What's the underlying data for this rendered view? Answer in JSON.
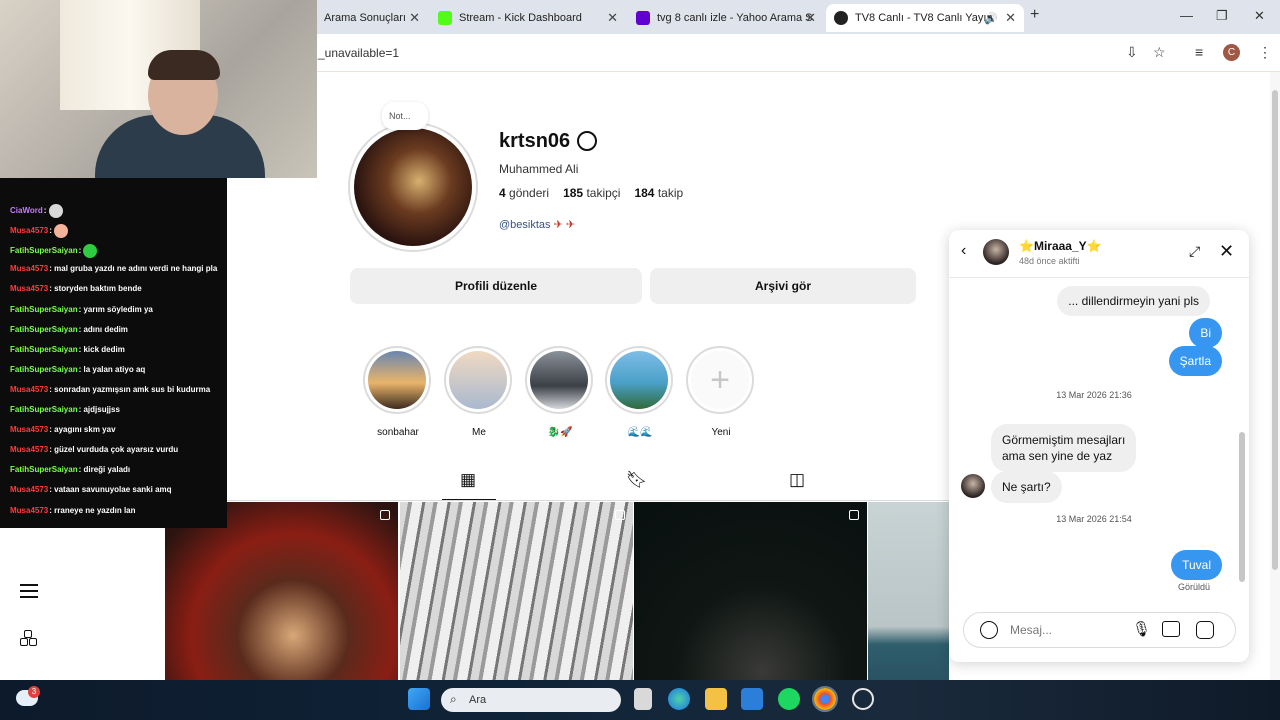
{
  "browser": {
    "tabs": [
      {
        "label": "Arama Sonuçları",
        "favicon_color": "#dfe3eb"
      },
      {
        "label": "Stream - Kick Dashboard",
        "favicon_color": "#53fc18"
      },
      {
        "label": "tvg 8 canlı izle - Yahoo Arama S",
        "favicon_color": "#6001d2"
      },
      {
        "label": "TV8 Canlı - TV8 Canlı Yayın",
        "favicon_color": "#222222"
      }
    ],
    "new_tab": "+",
    "url": "_unavailable=1",
    "profile_initial": "C"
  },
  "chat": {
    "messages": [
      {
        "user": "CiaWord",
        "text": "",
        "color": "#c97cff",
        "emoji": true,
        "emoji_color": "#d9d9d9"
      },
      {
        "user": "Musa4573",
        "text": "",
        "color": "#ff3b3b",
        "emoji": true,
        "emoji_color": "#f4b29a"
      },
      {
        "user": "FatihSuperSaiyan",
        "text": "",
        "color": "#7cff4b",
        "emoji": true,
        "emoji_color": "#2ecc40"
      },
      {
        "user": "Musa4573",
        "text": "mal gruba yazdı ne adını verdi ne hangi pla",
        "color": "#ff3b3b"
      },
      {
        "user": "Musa4573",
        "text": "storyden baktım bende",
        "color": "#ff3b3b"
      },
      {
        "user": "FatihSuperSaiyan",
        "text": "yarım söyledim ya",
        "color": "#7cff4b"
      },
      {
        "user": "FatihSuperSaiyan",
        "text": "adını dedim",
        "color": "#7cff4b"
      },
      {
        "user": "FatihSuperSaiyan",
        "text": "kick dedim",
        "color": "#7cff4b"
      },
      {
        "user": "FatihSuperSaiyan",
        "text": "la yalan atiyo aq",
        "color": "#7cff4b"
      },
      {
        "user": "Musa4573",
        "text": "sonradan yazmışsın amk sus bi kudurma",
        "color": "#ff3b3b"
      },
      {
        "user": "FatihSuperSaiyan",
        "text": "ajdjsujjss",
        "color": "#7cff4b"
      },
      {
        "user": "Musa4573",
        "text": "ayagını skm yav",
        "color": "#ff3b3b"
      },
      {
        "user": "Musa4573",
        "text": "güzel vurduda çok ayarsız vurdu",
        "color": "#ff3b3b"
      },
      {
        "user": "FatihSuperSaiyan",
        "text": "direği yaladı",
        "color": "#7cff4b"
      },
      {
        "user": "Musa4573",
        "text": "vataan savunuyolae sanki amq",
        "color": "#ff3b3b"
      },
      {
        "user": "Musa4573",
        "text": "rraneye ne yazdın lan",
        "color": "#ff3b3b"
      }
    ]
  },
  "profile": {
    "note": "Not...",
    "username": "krtsn06",
    "full_name": "Muhammed Ali",
    "posts_count": "4",
    "posts_label": "gönderi",
    "followers_count": "185",
    "followers_label": "takipçi",
    "following_count": "184",
    "following_label": "takip",
    "link": "@besiktas",
    "edit_button": "Profili düzenle",
    "archive_button": "Arşivi gör",
    "highlights": [
      {
        "label": "sonbahar",
        "color1": "#e9b46a",
        "color2": "#3a4b6b"
      },
      {
        "label": "Me",
        "color1": "#f0d9c2",
        "color2": "#8ea6c4"
      },
      {
        "label": "🐉🚀",
        "color1": "#b7bcc3",
        "color2": "#3b4047"
      },
      {
        "label": "🌊🌊",
        "color1": "#7dbde8",
        "color2": "#2f6b3a"
      },
      {
        "label": "Yeni",
        "color1": "#fafafa",
        "color2": "#fafafa"
      }
    ]
  },
  "dm": {
    "name": "⭐Miraaa_Y⭐",
    "status": "48d önce aktifti",
    "messages": [
      {
        "kind": "in_top",
        "text": "... dillendirmeyin yani pls"
      },
      {
        "kind": "out",
        "text": "Bi"
      },
      {
        "kind": "out",
        "text": "Şartla"
      },
      {
        "kind": "stamp",
        "text": "13 Mar 2026 21:36"
      },
      {
        "kind": "in",
        "text": "Görmemiştim mesajları\nama sen yine de yaz"
      },
      {
        "kind": "in",
        "text": "Ne şartı?"
      },
      {
        "kind": "stamp",
        "text": "13 Mar 2026 21:54"
      },
      {
        "kind": "out",
        "text": "Tuval"
      }
    ],
    "seen": "Görüldü",
    "composer_placeholder": "Mesaj..."
  },
  "taskbar": {
    "search_placeholder": "Ara",
    "weather_badge": "3"
  }
}
